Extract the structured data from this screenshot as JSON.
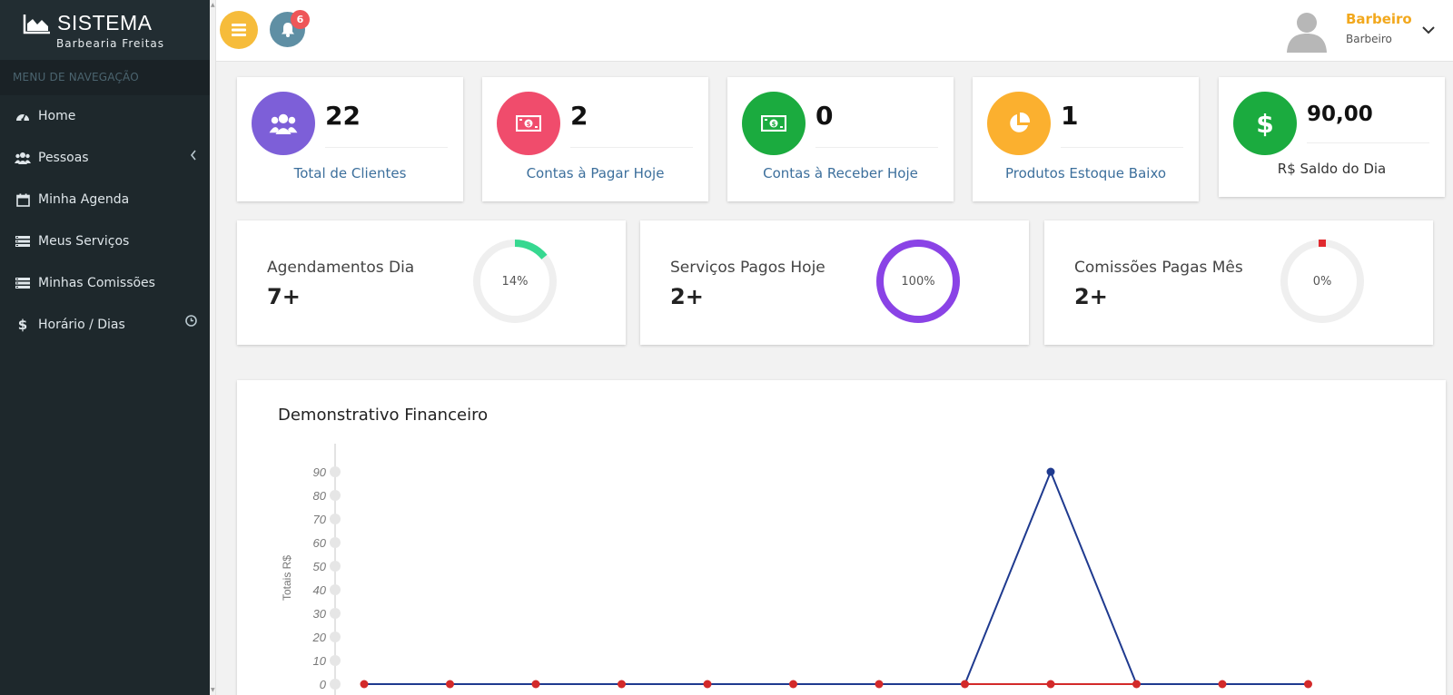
{
  "sidebar": {
    "brand_title": "SISTEMA",
    "brand_subtitle": "Barbearia Freitas",
    "nav_header": "MENU DE NAVEGAÇÃO",
    "items": [
      {
        "label": "Home",
        "icon": "dashboard-icon"
      },
      {
        "label": "Pessoas",
        "icon": "users-icon"
      },
      {
        "label": "Minha Agenda",
        "icon": "calendar-icon"
      },
      {
        "label": "Meus Serviços",
        "icon": "list-icon"
      },
      {
        "label": "Minhas Comissões",
        "icon": "list-icon"
      },
      {
        "label": "Horário / Dias",
        "icon": "dollar-icon"
      }
    ]
  },
  "topbar": {
    "notification_count": "6",
    "user_name": "Barbeiro",
    "user_role": "Barbeiro"
  },
  "stats": [
    {
      "value": "22",
      "label": "Total de Clientes",
      "color": "#7d5fd8",
      "icon": "users-icon"
    },
    {
      "value": "2",
      "label": "Contas à Pagar Hoje",
      "color": "#f04c6c",
      "icon": "money-icon"
    },
    {
      "value": "0",
      "label": "Contas à Receber Hoje",
      "color": "#1bab3f",
      "icon": "money-icon"
    },
    {
      "value": "1",
      "label": "Produtos Estoque Baixo",
      "color": "#fbb02f",
      "icon": "pie-chart-icon"
    },
    {
      "value": "90,00",
      "label": "R$ Saldo do Dia",
      "color": "#1bab3f",
      "icon": "dollar-icon"
    }
  ],
  "progress": [
    {
      "label": "Agendamentos Dia",
      "value": "7+",
      "percent_text": "14%",
      "fraction": 0.14,
      "color": "#36d890"
    },
    {
      "label": "Serviços Pagos Hoje",
      "value": "2+",
      "percent_text": "100%",
      "fraction": 1.0,
      "color": "#8a43e6"
    },
    {
      "label": "Comissões Pagas Mês",
      "value": "2+",
      "percent_text": "0%",
      "fraction": 0.0,
      "color": "#e0292e"
    }
  ],
  "chart_data": {
    "type": "line",
    "title": "Demonstrativo Financeiro",
    "ylabel": "Totais R$",
    "ylim": [
      0,
      90
    ],
    "yticks": [
      0,
      10,
      20,
      30,
      40,
      50,
      60,
      70,
      80,
      90
    ],
    "series": [
      {
        "color": "#1f3a8f",
        "values": [
          0,
          0,
          0,
          0,
          0,
          0,
          0,
          0,
          90,
          0,
          0,
          0
        ]
      },
      {
        "color": "#d32a2a",
        "values": [
          0,
          0,
          0,
          0,
          0,
          0,
          0,
          0,
          0,
          0,
          0,
          0
        ]
      }
    ],
    "grid": false
  }
}
